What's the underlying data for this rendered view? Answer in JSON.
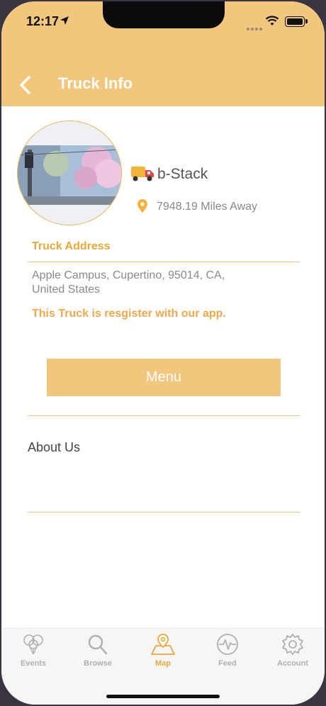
{
  "status_bar": {
    "time": "12:17"
  },
  "header": {
    "title": "Truck Info"
  },
  "truck": {
    "name": "b-Stack",
    "distance": "7948.19 Miles Away",
    "address_label": "Truck Address",
    "address_line1": "Apple Campus, Cupertino, 95014, CA,",
    "address_line2": "United States",
    "registered_note": "This Truck is resgister with our app."
  },
  "menu_button": {
    "label": "Menu"
  },
  "about": {
    "label": "About Us"
  },
  "tabbar": {
    "items": [
      {
        "label": "Events",
        "icon": "balloons-icon"
      },
      {
        "label": "Browse",
        "icon": "search-icon"
      },
      {
        "label": "Map",
        "icon": "map-icon"
      },
      {
        "label": "Feed",
        "icon": "pulse-icon"
      },
      {
        "label": "Account",
        "icon": "gear-icon"
      }
    ],
    "active": "Map"
  },
  "colors": {
    "accent": "#f2c77d",
    "accent_dark": "#e8a838"
  }
}
